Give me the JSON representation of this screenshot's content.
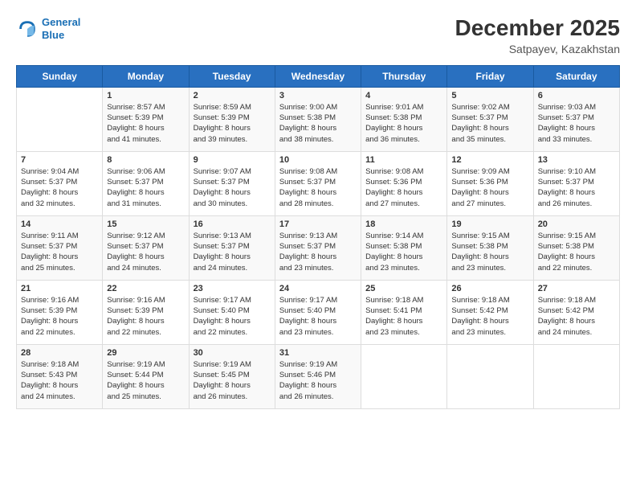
{
  "header": {
    "logo_line1": "General",
    "logo_line2": "Blue",
    "title": "December 2025",
    "subtitle": "Satpayev, Kazakhstan"
  },
  "days_of_week": [
    "Sunday",
    "Monday",
    "Tuesday",
    "Wednesday",
    "Thursday",
    "Friday",
    "Saturday"
  ],
  "weeks": [
    [
      {
        "day": "",
        "info": ""
      },
      {
        "day": "1",
        "info": "Sunrise: 8:57 AM\nSunset: 5:39 PM\nDaylight: 8 hours\nand 41 minutes."
      },
      {
        "day": "2",
        "info": "Sunrise: 8:59 AM\nSunset: 5:39 PM\nDaylight: 8 hours\nand 39 minutes."
      },
      {
        "day": "3",
        "info": "Sunrise: 9:00 AM\nSunset: 5:38 PM\nDaylight: 8 hours\nand 38 minutes."
      },
      {
        "day": "4",
        "info": "Sunrise: 9:01 AM\nSunset: 5:38 PM\nDaylight: 8 hours\nand 36 minutes."
      },
      {
        "day": "5",
        "info": "Sunrise: 9:02 AM\nSunset: 5:37 PM\nDaylight: 8 hours\nand 35 minutes."
      },
      {
        "day": "6",
        "info": "Sunrise: 9:03 AM\nSunset: 5:37 PM\nDaylight: 8 hours\nand 33 minutes."
      }
    ],
    [
      {
        "day": "7",
        "info": "Sunrise: 9:04 AM\nSunset: 5:37 PM\nDaylight: 8 hours\nand 32 minutes."
      },
      {
        "day": "8",
        "info": "Sunrise: 9:06 AM\nSunset: 5:37 PM\nDaylight: 8 hours\nand 31 minutes."
      },
      {
        "day": "9",
        "info": "Sunrise: 9:07 AM\nSunset: 5:37 PM\nDaylight: 8 hours\nand 30 minutes."
      },
      {
        "day": "10",
        "info": "Sunrise: 9:08 AM\nSunset: 5:37 PM\nDaylight: 8 hours\nand 28 minutes."
      },
      {
        "day": "11",
        "info": "Sunrise: 9:08 AM\nSunset: 5:36 PM\nDaylight: 8 hours\nand 27 minutes."
      },
      {
        "day": "12",
        "info": "Sunrise: 9:09 AM\nSunset: 5:36 PM\nDaylight: 8 hours\nand 27 minutes."
      },
      {
        "day": "13",
        "info": "Sunrise: 9:10 AM\nSunset: 5:37 PM\nDaylight: 8 hours\nand 26 minutes."
      }
    ],
    [
      {
        "day": "14",
        "info": "Sunrise: 9:11 AM\nSunset: 5:37 PM\nDaylight: 8 hours\nand 25 minutes."
      },
      {
        "day": "15",
        "info": "Sunrise: 9:12 AM\nSunset: 5:37 PM\nDaylight: 8 hours\nand 24 minutes."
      },
      {
        "day": "16",
        "info": "Sunrise: 9:13 AM\nSunset: 5:37 PM\nDaylight: 8 hours\nand 24 minutes."
      },
      {
        "day": "17",
        "info": "Sunrise: 9:13 AM\nSunset: 5:37 PM\nDaylight: 8 hours\nand 23 minutes."
      },
      {
        "day": "18",
        "info": "Sunrise: 9:14 AM\nSunset: 5:38 PM\nDaylight: 8 hours\nand 23 minutes."
      },
      {
        "day": "19",
        "info": "Sunrise: 9:15 AM\nSunset: 5:38 PM\nDaylight: 8 hours\nand 23 minutes."
      },
      {
        "day": "20",
        "info": "Sunrise: 9:15 AM\nSunset: 5:38 PM\nDaylight: 8 hours\nand 22 minutes."
      }
    ],
    [
      {
        "day": "21",
        "info": "Sunrise: 9:16 AM\nSunset: 5:39 PM\nDaylight: 8 hours\nand 22 minutes."
      },
      {
        "day": "22",
        "info": "Sunrise: 9:16 AM\nSunset: 5:39 PM\nDaylight: 8 hours\nand 22 minutes."
      },
      {
        "day": "23",
        "info": "Sunrise: 9:17 AM\nSunset: 5:40 PM\nDaylight: 8 hours\nand 22 minutes."
      },
      {
        "day": "24",
        "info": "Sunrise: 9:17 AM\nSunset: 5:40 PM\nDaylight: 8 hours\nand 23 minutes."
      },
      {
        "day": "25",
        "info": "Sunrise: 9:18 AM\nSunset: 5:41 PM\nDaylight: 8 hours\nand 23 minutes."
      },
      {
        "day": "26",
        "info": "Sunrise: 9:18 AM\nSunset: 5:42 PM\nDaylight: 8 hours\nand 23 minutes."
      },
      {
        "day": "27",
        "info": "Sunrise: 9:18 AM\nSunset: 5:42 PM\nDaylight: 8 hours\nand 24 minutes."
      }
    ],
    [
      {
        "day": "28",
        "info": "Sunrise: 9:18 AM\nSunset: 5:43 PM\nDaylight: 8 hours\nand 24 minutes."
      },
      {
        "day": "29",
        "info": "Sunrise: 9:19 AM\nSunset: 5:44 PM\nDaylight: 8 hours\nand 25 minutes."
      },
      {
        "day": "30",
        "info": "Sunrise: 9:19 AM\nSunset: 5:45 PM\nDaylight: 8 hours\nand 26 minutes."
      },
      {
        "day": "31",
        "info": "Sunrise: 9:19 AM\nSunset: 5:46 PM\nDaylight: 8 hours\nand 26 minutes."
      },
      {
        "day": "",
        "info": ""
      },
      {
        "day": "",
        "info": ""
      },
      {
        "day": "",
        "info": ""
      }
    ]
  ]
}
